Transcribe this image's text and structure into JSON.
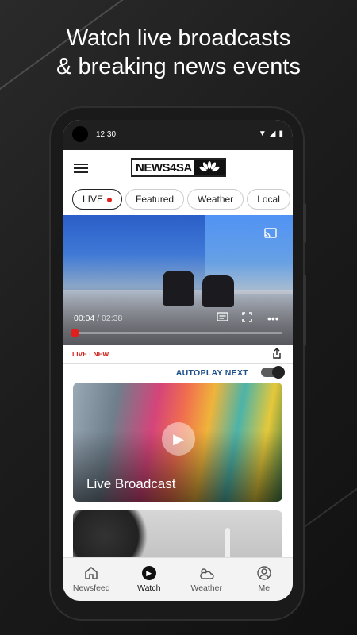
{
  "headline": {
    "line1": "Watch live broadcasts",
    "line2": "& breaking news events"
  },
  "status_bar": {
    "time": "12:30"
  },
  "app_bar": {
    "logo_text": "NEWS4SA"
  },
  "tabs": [
    {
      "label": "LIVE",
      "live_indicator": true,
      "active": true
    },
    {
      "label": "Featured"
    },
    {
      "label": "Weather"
    },
    {
      "label": "Local"
    }
  ],
  "video": {
    "current_time": "00:04",
    "separator": " / ",
    "duration": "02:38",
    "progress": 0.025,
    "icons": [
      "cast-icon",
      "captions-icon",
      "fullscreen-icon",
      "more-icon"
    ]
  },
  "meta": {
    "live_label": "LIVE",
    "new_label": "· NEW"
  },
  "autoplay": {
    "label": "AUTOPLAY NEXT",
    "enabled": true
  },
  "cards": [
    {
      "title": "Live Broadcast"
    },
    {
      "title": ""
    }
  ],
  "bottom_nav": [
    {
      "label": "Newsfeed",
      "icon": "home-icon"
    },
    {
      "label": "Watch",
      "icon": "play-circle-icon",
      "active": true
    },
    {
      "label": "Weather",
      "icon": "weather-icon"
    },
    {
      "label": "Me",
      "icon": "profile-icon"
    }
  ],
  "colors": {
    "live_red": "#e0201f",
    "autoplay_blue": "#1d4e89"
  }
}
